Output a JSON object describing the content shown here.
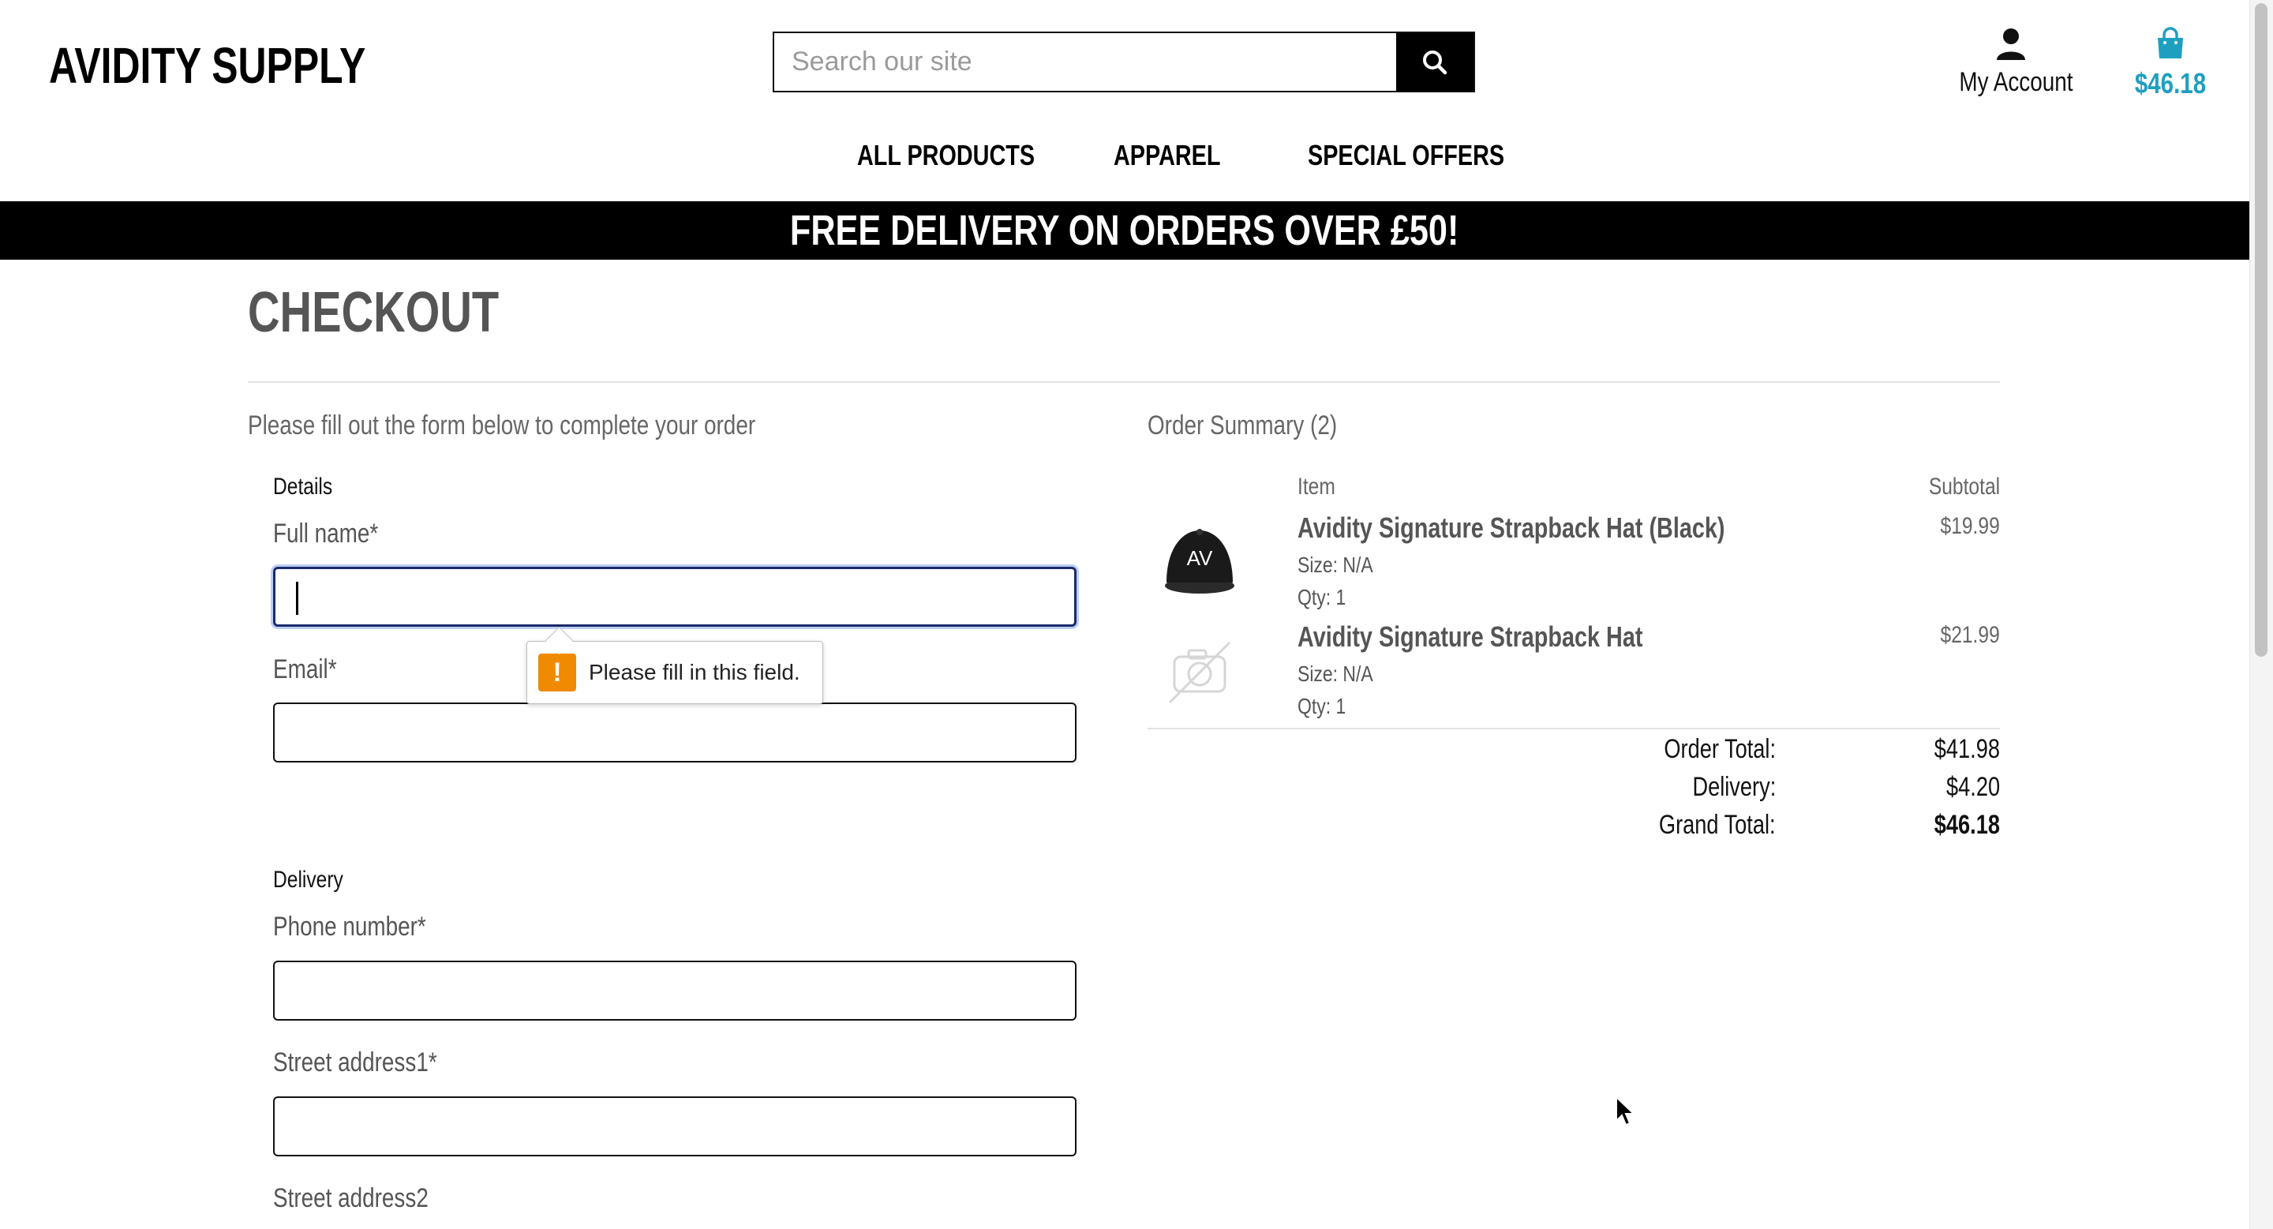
{
  "header": {
    "logo": "AVIDITY SUPPLY",
    "search_placeholder": "Search our site",
    "account_label": "My Account",
    "cart_total": "$46.18"
  },
  "nav": {
    "items": [
      "ALL PRODUCTS",
      "APPAREL",
      "SPECIAL OFFERS"
    ]
  },
  "banner": {
    "text": "FREE DELIVERY ON ORDERS OVER £50!"
  },
  "checkout": {
    "title": "CHECKOUT",
    "intro": "Please fill out the form below to complete your order",
    "details_heading": "Details",
    "full_name_label": "Full name*",
    "email_label": "Email*",
    "delivery_heading": "Delivery",
    "phone_label": "Phone number*",
    "street1_label": "Street address1*",
    "street2_label": "Street address2",
    "validation_message": "Please fill in this field."
  },
  "summary": {
    "title": "Order Summary (2)",
    "col_item": "Item",
    "col_subtotal": "Subtotal",
    "items": [
      {
        "name": "Avidity Signature Strapback Hat (Black)",
        "size": "Size: N/A",
        "qty": "Qty: 1",
        "price": "$19.99",
        "image_text": "AV",
        "image": "black-cap"
      },
      {
        "name": "Avidity Signature Strapback Hat",
        "size": "Size: N/A",
        "qty": "Qty: 1",
        "price": "$21.99",
        "image": "no-image-camera"
      }
    ],
    "order_total_label": "Order Total:",
    "order_total": "$41.98",
    "delivery_label": "Delivery:",
    "delivery": "$4.20",
    "grand_total_label": "Grand Total:",
    "grand_total": "$46.18"
  },
  "colors": {
    "accent": "#1f9fc0",
    "banner_bg": "#000000",
    "warning": "#f08a00"
  }
}
